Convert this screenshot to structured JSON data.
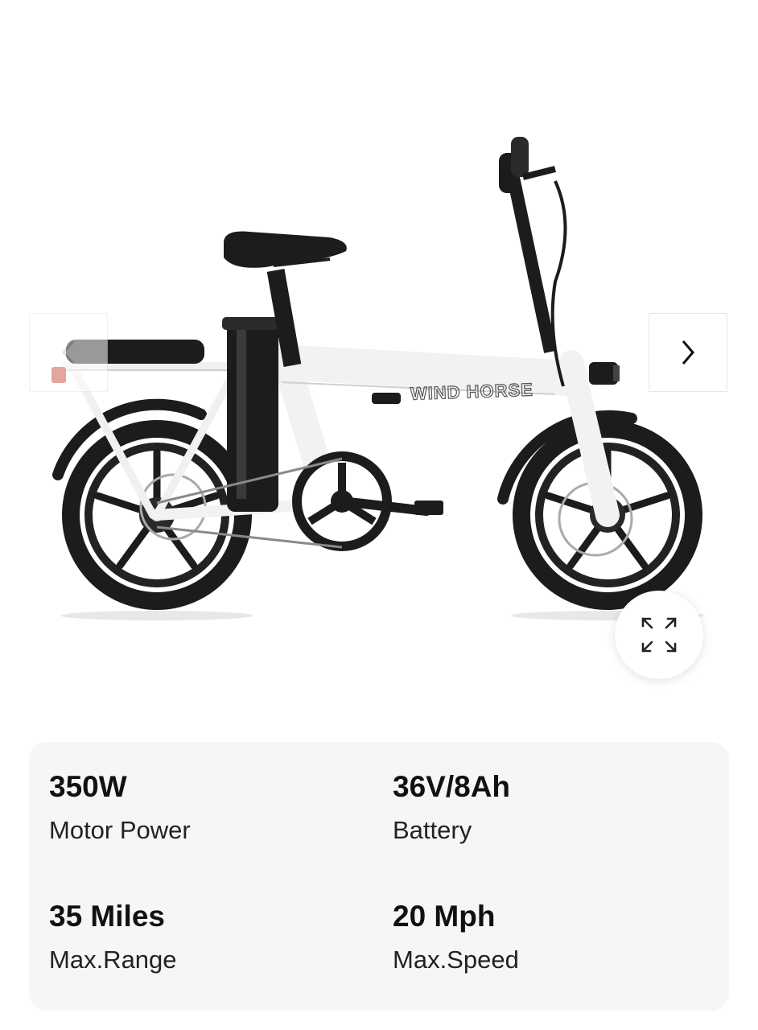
{
  "product": {
    "brand_wordmark": "WIND HORSE"
  },
  "specs": [
    {
      "value": "350W",
      "label": "Motor Power"
    },
    {
      "value": "36V/8Ah",
      "label": "Battery"
    },
    {
      "value": "35 Miles",
      "label": "Max.Range"
    },
    {
      "value": "20 Mph",
      "label": "Max.Speed"
    }
  ],
  "icons": {
    "prev": "chevron-left-icon",
    "next": "chevron-right-icon",
    "zoom": "expand-icon"
  },
  "colors": {
    "frame": "#f2f2f2",
    "tire": "#1a1a1a",
    "spec_panel_bg": "#f5f6f8"
  }
}
